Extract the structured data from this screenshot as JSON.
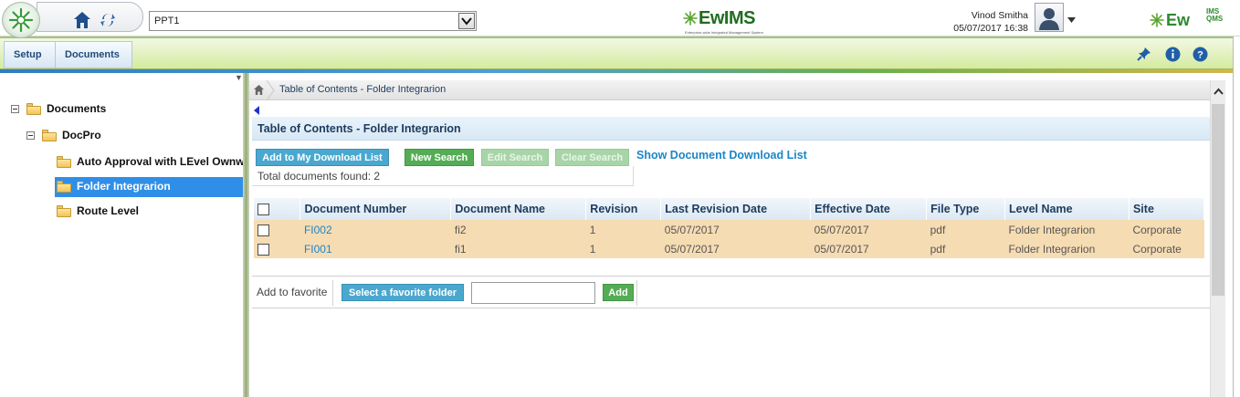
{
  "header": {
    "project_value": "PPT1",
    "brand_name": "EwIMS",
    "brand_tagline": "Enterprise-wide Integrated Management System",
    "user_name": "Vinod Smitha",
    "user_datetime": "05/07/2017 16:38",
    "right_brand": "Ew",
    "right_brand_suffix": "IMS QMS"
  },
  "nav": {
    "tabs": [
      {
        "label": "Setup"
      },
      {
        "label": "Documents"
      }
    ],
    "icons": [
      "pin-icon",
      "info-icon",
      "help-icon"
    ]
  },
  "tree": {
    "items": [
      {
        "label": "Documents",
        "level": 0,
        "expanded": true
      },
      {
        "label": "DocPro",
        "level": 1,
        "expanded": true
      },
      {
        "label": "Auto Approval with LEvel Ownwer",
        "level": 2
      },
      {
        "label": "Folder Integrarion",
        "level": 2,
        "selected": true
      },
      {
        "label": "Route Level",
        "level": 2
      }
    ]
  },
  "main": {
    "breadcrumb": "Table of Contents - Folder Integrarion",
    "section_title": "Table of Contents - Folder Integrarion",
    "buttons": {
      "add_download": "Add to My Download List",
      "new_search": "New Search",
      "edit_search": "Edit Search",
      "clear_search": "Clear Search",
      "show_download": "Show Document Download List"
    },
    "total_found": "Total documents found: 2",
    "table": {
      "columns": [
        "Document Number",
        "Document Name",
        "Revision",
        "Last Revision Date",
        "Effective Date",
        "File Type",
        "Level Name",
        "Site"
      ],
      "rows": [
        {
          "number": "FI002",
          "name": "fi2",
          "revision": "1",
          "last_rev": "05/07/2017",
          "effective": "05/07/2017",
          "file_type": "pdf",
          "level": "Folder Integrarion",
          "site": "Corporate"
        },
        {
          "number": "FI001",
          "name": "fi1",
          "revision": "1",
          "last_rev": "05/07/2017",
          "effective": "05/07/2017",
          "file_type": "pdf",
          "level": "Folder Integrarion",
          "site": "Corporate"
        }
      ]
    },
    "favorite": {
      "label": "Add to favorite",
      "select_button": "Select a favorite folder",
      "input_value": "",
      "add_button": "Add"
    }
  },
  "colors": {
    "nav_green": "#d5eb9f",
    "selected_blue": "#2f8fe8",
    "row_highlight": "#f6dcb3",
    "link_blue": "#1b86c8",
    "button_blue": "#4aa8d0",
    "button_green": "#54ad54"
  }
}
